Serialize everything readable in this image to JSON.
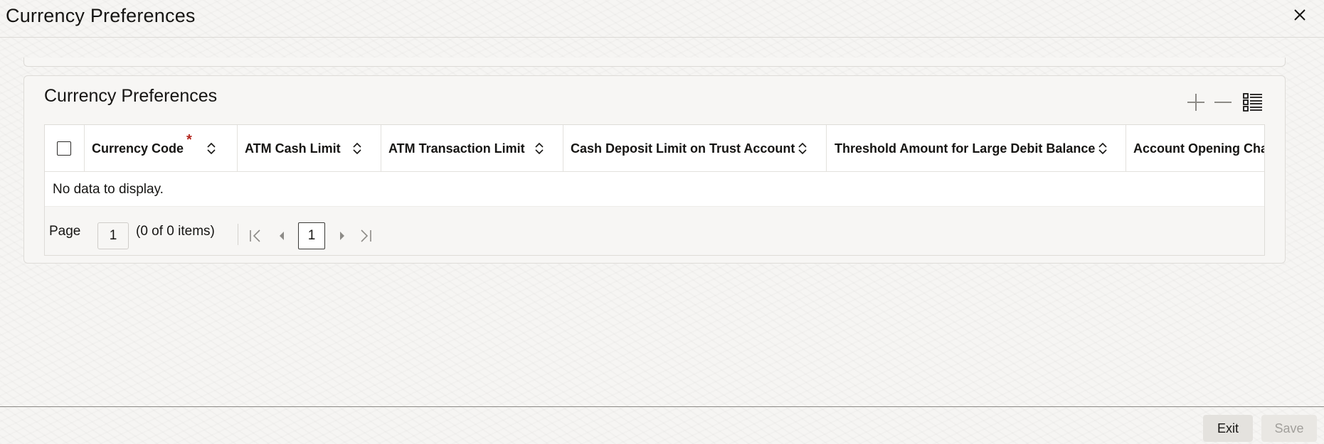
{
  "window": {
    "title": "Currency Preferences"
  },
  "section": {
    "title": "Currency Preferences"
  },
  "grid": {
    "columns": [
      {
        "label": "Currency Code",
        "required": true
      },
      {
        "label": "ATM Cash Limit"
      },
      {
        "label": "ATM Transaction Limit"
      },
      {
        "label": "Cash Deposit Limit on Trust Account"
      },
      {
        "label": "Threshold Amount for Large Debit Balance"
      },
      {
        "label": "Account Opening Char"
      }
    ],
    "required_marker": "*",
    "empty_message": "No data to display."
  },
  "pager": {
    "label": "Page",
    "page_value": "1",
    "count_text": "(0 of 0 items)",
    "current_page": "1"
  },
  "footer": {
    "exit_label": "Exit",
    "save_label": "Save"
  },
  "colors": {
    "required": "#b3261e",
    "text": "#161513",
    "disabled_text": "#a19f9b"
  }
}
